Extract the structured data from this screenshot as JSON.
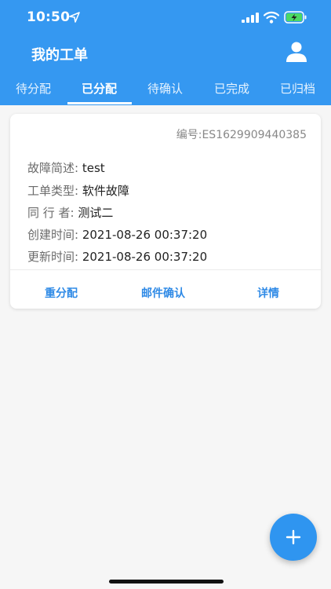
{
  "status": {
    "time": "10:50"
  },
  "header": {
    "title": "我的工单"
  },
  "tabs": [
    {
      "label": "待分配"
    },
    {
      "label": "已分配"
    },
    {
      "label": "待确认"
    },
    {
      "label": "已完成"
    },
    {
      "label": "已归档"
    }
  ],
  "card": {
    "order_no": "编号:ES1629909440385",
    "rows": [
      {
        "label": "故障简述: ",
        "value": "test"
      },
      {
        "label": "工单类型: ",
        "value": "软件故障"
      },
      {
        "label": "同 行 者: ",
        "value": "测试二"
      },
      {
        "label": "创建时间: ",
        "value": "2021-08-26 00:37:20"
      },
      {
        "label": "更新时间: ",
        "value": "2021-08-26 00:37:20"
      }
    ],
    "actions": {
      "reassign": "重分配",
      "email_confirm": "邮件确认",
      "details": "详情"
    }
  },
  "colors": {
    "primary": "#3598f1",
    "action_text": "#2f8ae6"
  }
}
